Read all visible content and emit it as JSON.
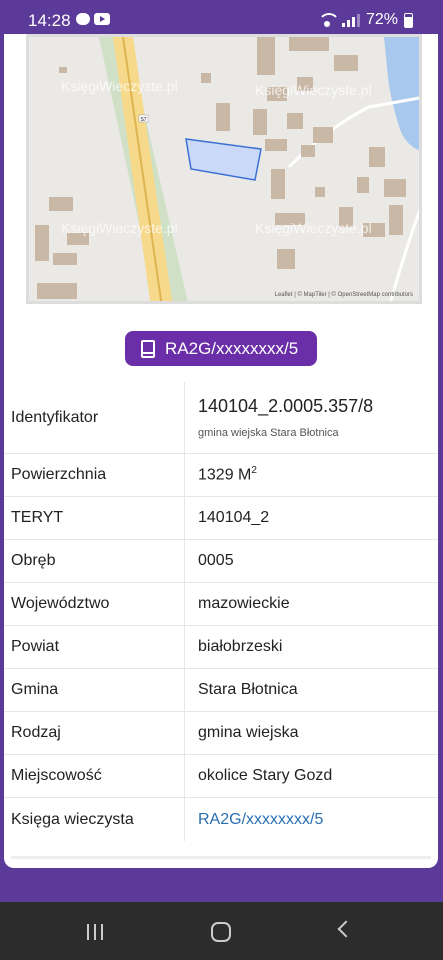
{
  "status": {
    "time": "14:28",
    "battery": "72%"
  },
  "map": {
    "watermark": "KsięgiWieczyste.pl",
    "attribution": "Leaflet | © MapTiler | © OpenStreetMap contributors",
    "road_label": "S7",
    "parcel_color": "#3d6fd6"
  },
  "kw_button": {
    "label": "RA2G/xxxxxxxx/5",
    "icon": "book-icon"
  },
  "details": {
    "identyfikator": {
      "label": "Identyfikator",
      "value": "140104_2.0005.357/8",
      "sub": "gmina wiejska Stara Błotnica"
    },
    "powierzchnia": {
      "label": "Powierzchnia",
      "value": "1329 M",
      "unit_sup": "2"
    },
    "teryt": {
      "label": "TERYT",
      "value": "140104_2"
    },
    "obreb": {
      "label": "Obręb",
      "value": "0005"
    },
    "wojewodztwo": {
      "label": "Województwo",
      "value": "mazowieckie"
    },
    "powiat": {
      "label": "Powiat",
      "value": "białobrzeski"
    },
    "gmina": {
      "label": "Gmina",
      "value": "Stara Błotnica"
    },
    "rodzaj": {
      "label": "Rodzaj",
      "value": "gmina wiejska"
    },
    "miejscowosc": {
      "label": "Miejscowość",
      "value": "okolice Stary Gozd"
    },
    "ksiega": {
      "label": "Księga wieczysta",
      "value": "RA2G/xxxxxxxx/5"
    }
  },
  "colors": {
    "brand": "#6a2fa8",
    "link": "#2a6fb0"
  }
}
